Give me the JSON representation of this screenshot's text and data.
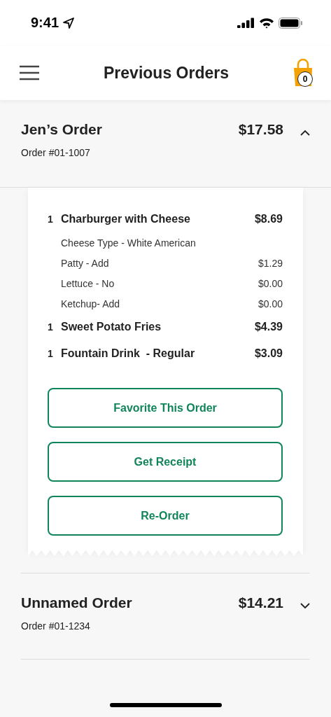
{
  "status_bar": {
    "time": "9:41"
  },
  "header": {
    "title": "Previous Orders",
    "cart_count": "0"
  },
  "orders": [
    {
      "name": "Jen’s Order",
      "number": "Order #01-1007",
      "total": "$17.58",
      "expanded": true,
      "lines": [
        {
          "kind": "item",
          "qty": "1",
          "name": "Charburger with Cheese",
          "price": "$8.69"
        },
        {
          "kind": "modifier",
          "name": "Cheese Type - White American"
        },
        {
          "kind": "modifier",
          "name": "Patty - Add",
          "price": "$1.29"
        },
        {
          "kind": "modifier",
          "name": "Lettuce - No",
          "price": "$0.00"
        },
        {
          "kind": "modifier",
          "name": "Ketchup- Add",
          "price": "$0.00"
        },
        {
          "kind": "item",
          "qty": "1",
          "name": "Sweet Potato Fries",
          "price": "$4.39"
        },
        {
          "kind": "item",
          "qty": "1",
          "name": "Fountain Drink  - Regular",
          "price": "$3.09"
        }
      ],
      "buttons": [
        "Favorite This Order",
        "Get Receipt",
        "Re-Order"
      ]
    },
    {
      "name": "Unnamed Order",
      "number": "Order #01-1234",
      "total": "$14.21",
      "expanded": false
    }
  ]
}
